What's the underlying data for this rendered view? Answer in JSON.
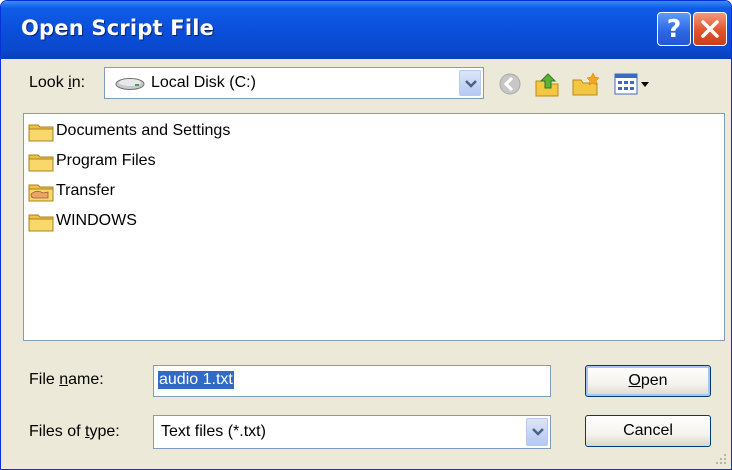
{
  "window": {
    "title": "Open Script File"
  },
  "lookin": {
    "label_pre": "Look ",
    "label_key": "i",
    "label_post": "n:",
    "value": "Local Disk (C:)"
  },
  "files": [
    {
      "name": "Documents and Settings",
      "icon": "folder-icon"
    },
    {
      "name": "Program Files",
      "icon": "folder-icon"
    },
    {
      "name": "Transfer",
      "icon": "shared-folder-icon"
    },
    {
      "name": "WINDOWS",
      "icon": "folder-icon"
    }
  ],
  "filename": {
    "label_pre": "File ",
    "label_key": "n",
    "label_post": "ame:",
    "value": "audio 1.txt"
  },
  "filetype": {
    "label_pre": "Files of ",
    "label_key": "t",
    "label_post": "ype:",
    "value": "Text files (*.txt)"
  },
  "buttons": {
    "open_key": "O",
    "open_rest": "pen",
    "cancel": "Cancel"
  },
  "colors": {
    "titlebar": "#0A4ED8",
    "dialog_bg": "#ECE9D8",
    "selection": "#316AC5"
  }
}
